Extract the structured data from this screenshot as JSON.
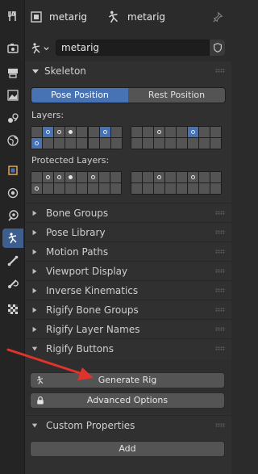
{
  "header": {
    "object_name": "metarig",
    "armature_name": "metarig",
    "data_field_value": "metarig"
  },
  "tabs": [
    {
      "name": "tool-icon"
    },
    {
      "name": "render-icon"
    },
    {
      "name": "output-icon"
    },
    {
      "name": "view-layer-icon"
    },
    {
      "name": "scene-icon"
    },
    {
      "name": "world-icon"
    },
    {
      "name": "object-icon"
    },
    {
      "name": "modifier-icon"
    },
    {
      "name": "physics-icon"
    },
    {
      "name": "object-data-armature-icon",
      "active": true
    },
    {
      "name": "bone-icon"
    },
    {
      "name": "bone-constraint-icon"
    },
    {
      "name": "texture-icon"
    }
  ],
  "skeleton": {
    "title": "Skeleton",
    "pose_position": "Pose Position",
    "rest_position": "Rest Position",
    "layers_label": "Layers:",
    "protected_layers_label": "Protected Layers:"
  },
  "panels": [
    "Bone Groups",
    "Pose Library",
    "Motion Paths",
    "Viewport Display",
    "Inverse Kinematics",
    "Rigify Bone Groups",
    "Rigify Layer Names",
    "Rigify Buttons"
  ],
  "rigify": {
    "generate": "Generate Rig",
    "advanced": "Advanced Options"
  },
  "custom_properties": {
    "title": "Custom Properties",
    "add": "Add"
  },
  "colors": {
    "accent": "#4772b3",
    "annotation_arrow": "#e0332c"
  }
}
